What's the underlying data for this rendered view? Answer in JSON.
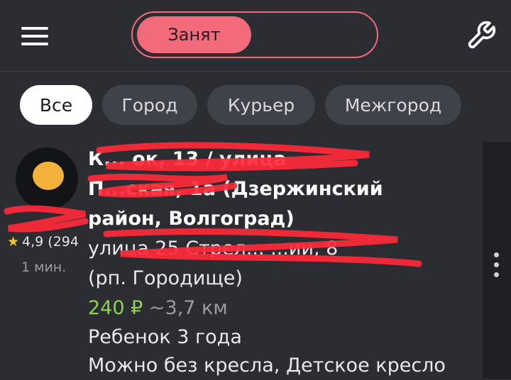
{
  "header": {
    "menu_icon": "hamburger-menu-icon",
    "status_label": "Занят",
    "settings_icon": "wrench-icon"
  },
  "filters": [
    {
      "label": "Все",
      "active": true
    },
    {
      "label": "Город",
      "active": false
    },
    {
      "label": "Курьер",
      "active": false
    },
    {
      "label": "Межгород",
      "active": false
    }
  ],
  "order": {
    "rating": "4,9 (294",
    "time": "1 мин.",
    "from_line1": "К... ок, 13 / улица",
    "from_line2": "П...ская, 1а (Дзержинский",
    "from_line3": "район, Волгоград)",
    "to_line1": "улица 25 Стрел... ...ии, 8",
    "to_line2": "(рп. Городище)",
    "price": "240 ₽",
    "distance": "~3,7 км",
    "comment_line1": "Ребенок 3 года",
    "comment_line2": "Можно без кресла, Детское кресло"
  },
  "colors": {
    "background": "#2b2d33",
    "accent": "#f36a7a",
    "price": "#8bd34c",
    "redaction": "#ff2a3a"
  }
}
